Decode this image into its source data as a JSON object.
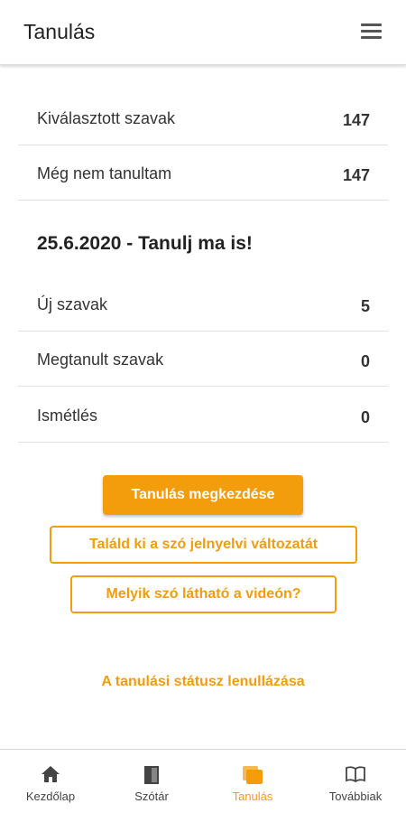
{
  "header": {
    "title": "Tanulás",
    "menu_icon": "hamburger-menu-icon"
  },
  "stats_top": [
    {
      "label": "Kiválasztott szavak",
      "value": "147"
    },
    {
      "label": "Még nem tanultam",
      "value": "147"
    }
  ],
  "daily": {
    "heading": "25.6.2020 - Tanulj ma is!",
    "rows": [
      {
        "label": "Új szavak",
        "value": "5"
      },
      {
        "label": "Megtanult szavak",
        "value": "0"
      },
      {
        "label": "Ismétlés",
        "value": "0"
      }
    ]
  },
  "actions": {
    "start_label": "Tanulás megkezdése",
    "guess_sign_label": "Találd ki a szó jelnyelvi változatát",
    "which_word_label": "Melyik szó látható a videón?",
    "reset_label": "A tanulási státusz lenullázása"
  },
  "bottom_nav": [
    {
      "label": "Kezdőlap",
      "icon": "home-icon",
      "active": false
    },
    {
      "label": "Szótár",
      "icon": "dictionary-book-icon",
      "active": false
    },
    {
      "label": "Tanulás",
      "icon": "learning-cards-icon",
      "active": true
    },
    {
      "label": "Továbbiak",
      "icon": "open-book-icon",
      "active": false
    }
  ],
  "colors": {
    "accent": "#f39c0c",
    "text": "#333333",
    "divider": "#e0e0e0"
  }
}
